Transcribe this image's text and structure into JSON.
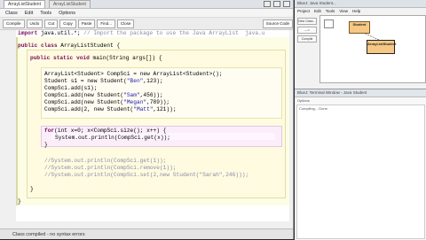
{
  "editor": {
    "tabs": [
      "ArrayListStudent",
      "ArrayListStudent"
    ],
    "menu": [
      "Class",
      "Edit",
      "Tools",
      "Options"
    ],
    "toolbar": {
      "compile": "Compile",
      "undo": "Undo",
      "cut": "Cut",
      "copy": "Copy",
      "paste": "Paste",
      "find": "Find...",
      "close": "Close",
      "view": "Source Code"
    },
    "code": {
      "l1a": "import",
      "l1b": " java.util.*; ",
      "l1c": "// Import the package to use the Java ArrayList  java.u",
      "l2a": "public class",
      "l2b": " ArrayListStudent {",
      "l3a": "public static void",
      "l3b": " main(String args[]) {",
      "l4": "ArrayList<Student> CompSci = new ArrayList<Student>();",
      "l5a": "Student s1 = new Student(",
      "l5b": "\"Ben\"",
      "l5c": ",123);",
      "l6": "CompSci.add(s1);",
      "l7a": "CompSci.add(new Student(",
      "l7b": "\"Sam\"",
      "l7c": ",456));",
      "l8a": "CompSci.add(new Student(",
      "l8b": "\"Megan\"",
      "l8c": ",789));",
      "l9a": "CompSci.add(2, new Student(",
      "l9b": "\"Matt\"",
      "l9c": ",121));",
      "l10a": "for",
      "l10b": "(int x=0; x<CompSci.size(); x++) {",
      "l11": "System.out.println(CompSci.get(x));",
      "l12": "}",
      "l13": "//System.out.println(CompSci.get(1));",
      "l14": "//System.out.println(CompSci.remove(1));",
      "l15": "//System.out.println(CompSci.set(2,new Student(\"Sarah\",246)));",
      "l16": "}",
      "l17": "}"
    },
    "status": "Class compiled - no syntax errors"
  },
  "bluej": {
    "title": "BlueJ: Java Student...",
    "menu": [
      "Project",
      "Edit",
      "Tools",
      "View",
      "Help"
    ],
    "buttons": [
      "New Class...",
      "--->",
      "Compile"
    ],
    "classes": {
      "student": "Student",
      "als": "ArrayListStudent"
    },
    "terminal": {
      "title": "BlueJ: Terminal Window - Java Student",
      "sub": "Options",
      "header": "Compiling... Done."
    }
  }
}
